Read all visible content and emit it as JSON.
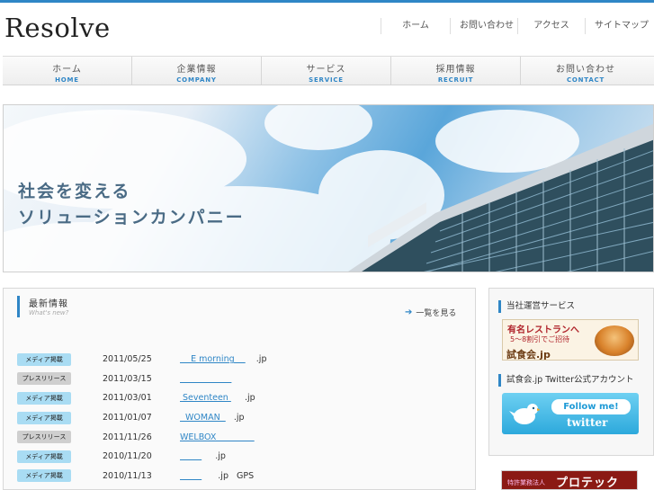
{
  "brand": {
    "logo": "Resolve"
  },
  "util_nav": [
    "ホーム",
    "お問い合わせ",
    "アクセス",
    "サイトマップ"
  ],
  "global_nav": [
    {
      "jp": "ホーム",
      "en": "HOME"
    },
    {
      "jp": "企業情報",
      "en": "COMPANY"
    },
    {
      "jp": "サービス",
      "en": "SERVICE"
    },
    {
      "jp": "採用情報",
      "en": "RECRUIT"
    },
    {
      "jp": "お問い合わせ",
      "en": "CONTACT"
    }
  ],
  "hero": {
    "line1": "社会を変える",
    "line2": "ソリューションカンパニー"
  },
  "news": {
    "title": "最新情報",
    "subtitle": "What's new?",
    "more": "一覧を見る",
    "items": [
      {
        "badge": "メディア掲載",
        "type": "media",
        "date": "2011/05/25",
        "link": "    E morning    ",
        "rest": "    .jp"
      },
      {
        "badge": "プレスリリース",
        "type": "press",
        "date": "2011/03/15",
        "link": "                   ",
        "rest": ""
      },
      {
        "badge": "メディア掲載",
        "type": "media",
        "date": "2011/03/01",
        "link": " Seventeen ",
        "rest": "     .jp"
      },
      {
        "badge": "メディア掲載",
        "type": "media",
        "date": "2011/01/07",
        "link": "  WOMAN  ",
        "rest": "   .jp"
      },
      {
        "badge": "プレスリリース",
        "type": "press",
        "date": "2011/11/26",
        "link": "WELBOX              ",
        "rest": ""
      },
      {
        "badge": "メディア掲載",
        "type": "media",
        "date": "2010/11/20",
        "link": "        ",
        "rest": "     .jp"
      },
      {
        "badge": "メディア掲載",
        "type": "media",
        "date": "2010/11/13",
        "link": "        ",
        "rest": "      .jp   GPS"
      }
    ]
  },
  "sidebar": {
    "services_title": "当社運営サービス",
    "banner1": {
      "line1": "有名レストランへ",
      "line2": "5～8割引でご招待",
      "logo": "試食会.jp"
    },
    "twitter_title": "試食会.jp Twitter公式アカウント",
    "banner2": {
      "follow": "Follow me!",
      "service": "twitter"
    },
    "banner3": {
      "small": "特許業務法人",
      "big": "プロテック"
    }
  },
  "colors": {
    "accent": "#2f86c6",
    "media_badge": "#a9dcf3",
    "press_badge": "#cfcfcf"
  }
}
